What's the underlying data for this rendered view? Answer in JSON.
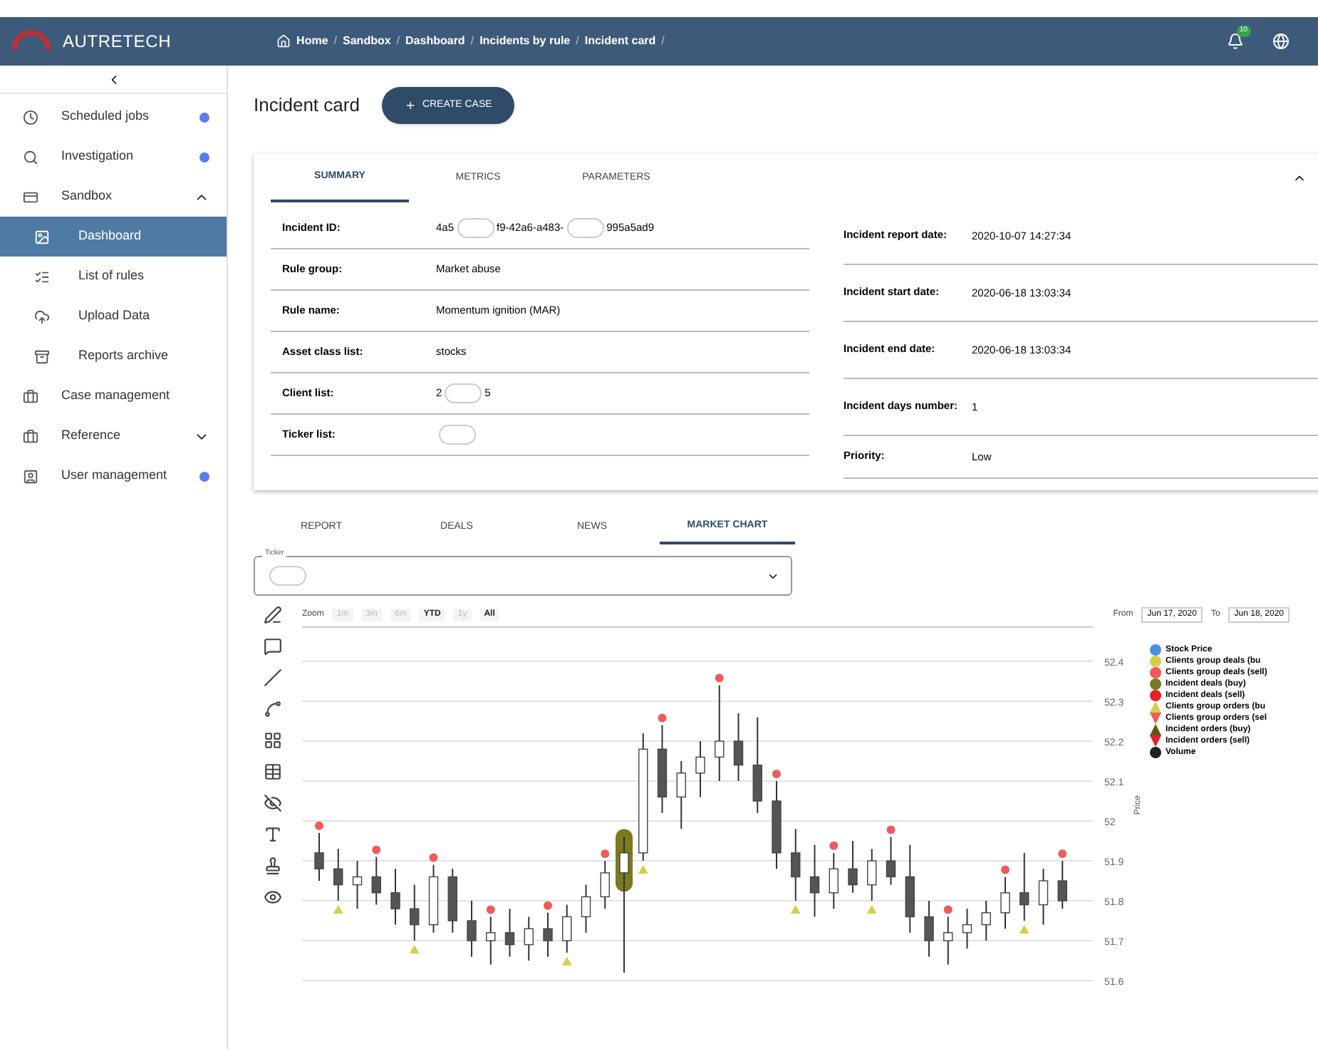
{
  "header": {
    "logo_text": "AUTRETECH",
    "breadcrumbs": [
      {
        "label": "Home",
        "separator": "/"
      },
      {
        "label": "Sandbox",
        "separator": "/"
      },
      {
        "label": "Dashboard",
        "separator": "/"
      },
      {
        "label": "Incidents by rule",
        "separator": "/"
      },
      {
        "label": "Incident card",
        "separator": "/"
      }
    ],
    "notification_count": "10"
  },
  "sidebar": {
    "items": [
      {
        "label": "Scheduled jobs",
        "badge": true,
        "selected": false
      },
      {
        "label": "Investigation",
        "badge": true,
        "selected": false
      },
      {
        "label": "Sandbox",
        "badge": false,
        "expanded": true,
        "selected": false,
        "children": [
          {
            "label": "Dashboard",
            "selected": true
          },
          {
            "label": "List of rules",
            "selected": false
          },
          {
            "label": "Upload Data",
            "selected": false
          },
          {
            "label": "Reports archive",
            "selected": false
          }
        ]
      },
      {
        "label": "Case management",
        "badge": false,
        "selected": false
      },
      {
        "label": "Reference",
        "badge": false,
        "expanded": false,
        "selected": false
      },
      {
        "label": "User management",
        "badge": true,
        "selected": false
      }
    ]
  },
  "page": {
    "title": "Incident card",
    "create_button": "CREATE CASE"
  },
  "card": {
    "tabs": [
      {
        "label": "SUMMARY",
        "selected": true
      },
      {
        "label": "METRICS",
        "selected": false
      },
      {
        "label": "PARAMETERS",
        "selected": false
      }
    ],
    "left_fields": [
      {
        "label": "Incident ID:",
        "parts": [
          {
            "kind": "text",
            "text": "4a5"
          },
          {
            "kind": "redacted"
          },
          {
            "kind": "text",
            "text": "f9-42a6-a483-"
          },
          {
            "kind": "redacted"
          },
          {
            "kind": "text",
            "text": "995a5ad9"
          }
        ]
      },
      {
        "label": "Rule group:",
        "parts": [
          {
            "kind": "text",
            "text": "Market abuse"
          }
        ]
      },
      {
        "label": "Rule name:",
        "parts": [
          {
            "kind": "text",
            "text": "Momentum ignition (MAR)"
          }
        ]
      },
      {
        "label": "Asset class list:",
        "parts": [
          {
            "kind": "text",
            "text": "stocks"
          }
        ]
      },
      {
        "label": "Client list:",
        "parts": [
          {
            "kind": "text",
            "text": "2"
          },
          {
            "kind": "redacted"
          },
          {
            "kind": "text",
            "text": "5"
          }
        ]
      },
      {
        "label": "Ticker list:",
        "parts": [
          {
            "kind": "redacted"
          }
        ]
      }
    ],
    "right_fields": [
      {
        "label": "Incident report date:",
        "value": "2020-10-07 14:27:34"
      },
      {
        "label": "Incident start date:",
        "value": "2020-06-18 13:03:34"
      },
      {
        "label": "Incident end date:",
        "value": "2020-06-18 13:03:34"
      },
      {
        "label": "Incident days number:",
        "value": "1"
      },
      {
        "label": "Priority:",
        "value": "Low"
      }
    ]
  },
  "lower_tabs": [
    {
      "label": "REPORT",
      "selected": false
    },
    {
      "label": "DEALS",
      "selected": false
    },
    {
      "label": "NEWS",
      "selected": false
    },
    {
      "label": "MARKET CHART",
      "selected": true
    }
  ],
  "ticker_field": {
    "label": "Ticker"
  },
  "chart": {
    "zoom_label": "Zoom",
    "zoom_buttons": [
      {
        "label": "1m",
        "disabled": true
      },
      {
        "label": "3m",
        "disabled": true
      },
      {
        "label": "6m",
        "disabled": true
      },
      {
        "label": "YTD",
        "disabled": false
      },
      {
        "label": "1y",
        "disabled": true
      },
      {
        "label": "All",
        "disabled": false
      }
    ],
    "from_label": "From",
    "from_value": "Jun 17, 2020",
    "to_label": "To",
    "to_value": "Jun 18, 2020",
    "chart_data": {
      "type": "candlestick",
      "ylabel": "Price",
      "ylim": [
        51.6,
        52.4
      ],
      "yticks": [
        {
          "value": 52.4,
          "label": "52.4"
        },
        {
          "value": 52.3,
          "label": "52.3"
        },
        {
          "value": 52.2,
          "label": "52.2"
        },
        {
          "value": 52.1,
          "label": "52.1"
        },
        {
          "value": 52,
          "label": "52"
        },
        {
          "value": 51.9,
          "label": "51.9"
        },
        {
          "value": 51.8,
          "label": "51.8"
        },
        {
          "value": 51.7,
          "label": "51.7"
        },
        {
          "value": 51.6,
          "label": "51.6"
        }
      ],
      "grid": true,
      "ohlc": [
        [
          51.92,
          51.97,
          51.85,
          51.88
        ],
        [
          51.88,
          51.93,
          51.8,
          51.84
        ],
        [
          51.84,
          51.9,
          51.78,
          51.86
        ],
        [
          51.86,
          51.91,
          51.79,
          51.82
        ],
        [
          51.82,
          51.88,
          51.74,
          51.78
        ],
        [
          51.78,
          51.84,
          51.7,
          51.74
        ],
        [
          51.74,
          51.89,
          51.72,
          51.86
        ],
        [
          51.86,
          51.88,
          51.72,
          51.75
        ],
        [
          51.75,
          51.8,
          51.66,
          51.7
        ],
        [
          51.7,
          51.76,
          51.64,
          51.72
        ],
        [
          51.72,
          51.78,
          51.66,
          51.69
        ],
        [
          51.69,
          51.76,
          51.65,
          51.73
        ],
        [
          51.73,
          51.77,
          51.66,
          51.7
        ],
        [
          51.7,
          51.79,
          51.67,
          51.76
        ],
        [
          51.76,
          51.84,
          51.72,
          51.81
        ],
        [
          51.81,
          51.9,
          51.78,
          51.87
        ],
        [
          51.87,
          51.96,
          51.62,
          51.92
        ],
        [
          51.92,
          52.22,
          51.9,
          52.18
        ],
        [
          52.18,
          52.24,
          52.02,
          52.06
        ],
        [
          52.06,
          52.15,
          51.98,
          52.12
        ],
        [
          52.12,
          52.2,
          52.06,
          52.16
        ],
        [
          52.16,
          52.34,
          52.1,
          52.2
        ],
        [
          52.2,
          52.27,
          52.1,
          52.14
        ],
        [
          52.14,
          52.26,
          52.02,
          52.05
        ],
        [
          52.05,
          52.1,
          51.88,
          51.92
        ],
        [
          51.92,
          51.98,
          51.8,
          51.86
        ],
        [
          51.86,
          51.94,
          51.76,
          51.82
        ],
        [
          51.82,
          51.92,
          51.78,
          51.88
        ],
        [
          51.88,
          51.95,
          51.82,
          51.84
        ],
        [
          51.84,
          51.93,
          51.8,
          51.9
        ],
        [
          51.9,
          51.96,
          51.84,
          51.86
        ],
        [
          51.86,
          51.94,
          51.72,
          51.76
        ],
        [
          51.76,
          51.8,
          51.66,
          51.7
        ],
        [
          51.7,
          51.76,
          51.64,
          51.72
        ],
        [
          51.72,
          51.78,
          51.68,
          51.74
        ],
        [
          51.74,
          51.8,
          51.7,
          51.77
        ],
        [
          51.77,
          51.86,
          51.73,
          51.82
        ],
        [
          51.82,
          51.92,
          51.75,
          51.79
        ],
        [
          51.79,
          51.88,
          51.74,
          51.85
        ],
        [
          51.85,
          51.9,
          51.78,
          51.8
        ]
      ]
    },
    "legend": [
      {
        "label": "Stock Price",
        "color": "#4a90e2",
        "kind": "circle"
      },
      {
        "label": "Clients group deals (bu",
        "color": "#d4cf4a",
        "kind": "circle"
      },
      {
        "label": "Clients group deals (sell)",
        "color": "#f05a5a",
        "kind": "circle"
      },
      {
        "label": "Incident deals (buy)",
        "color": "#7a7a1e",
        "kind": "circle"
      },
      {
        "label": "Incident deals (sell)",
        "color": "#e8202a",
        "kind": "circle"
      },
      {
        "label": "Clients group orders (bu",
        "color": "#d4cf4a",
        "kind": "triangle-up"
      },
      {
        "label": "Clients group orders (sel",
        "color": "#f05a5a",
        "kind": "triangle-down"
      },
      {
        "label": "Incident orders (buy)",
        "color": "#5a5a14",
        "kind": "triangle-up"
      },
      {
        "label": "Incident orders (sell)",
        "color": "#e8202a",
        "kind": "triangle-down"
      },
      {
        "label": "Volume",
        "color": "#222222",
        "kind": "circle"
      }
    ]
  }
}
